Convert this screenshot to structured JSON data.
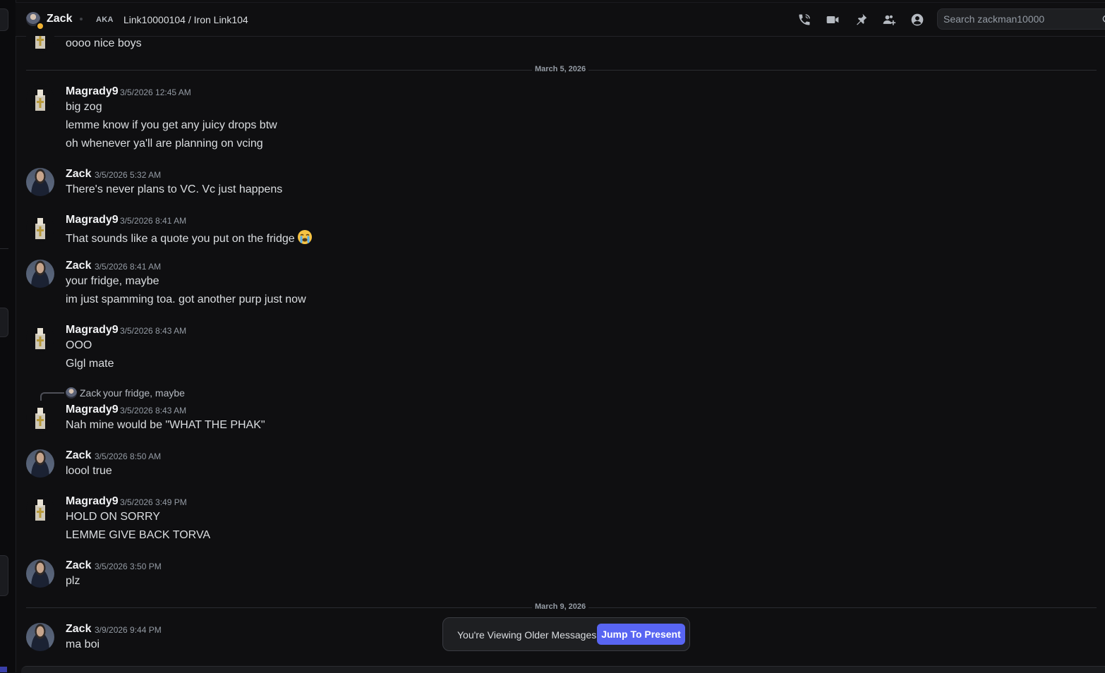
{
  "header": {
    "name": "Zack",
    "aka_label": "AKA",
    "aliases": "Link10000104 / Iron Link104",
    "search_placeholder": "Search zackman10000",
    "icons": [
      "voice-call-icon",
      "video-call-icon",
      "pin-icon",
      "add-friends-icon",
      "user-profile-icon",
      "search-icon"
    ],
    "status_color": "#f0b232"
  },
  "top_message": "oooo nice boys",
  "dividers": [
    "March 5, 2026",
    "March 9, 2026"
  ],
  "groups": [
    {
      "user": "Magrady9",
      "time": "3/5/2026 12:45 AM",
      "lines": [
        "big zog",
        "lemme know if you get any juicy drops btw",
        "oh whenever ya'll are planning on vcing"
      ]
    },
    {
      "user": "Zack",
      "time": "3/5/2026 5:32 AM",
      "lines": [
        "There's never plans to VC. Vc just happens"
      ]
    },
    {
      "user": "Magrady9",
      "time": "3/5/2026 8:41 AM",
      "lines": [
        "That sounds like a quote you put on the fridge"
      ]
    },
    {
      "user": "Zack",
      "time": "3/5/2026 8:41 AM",
      "lines": [
        "your fridge, maybe",
        "im just spamming toa. got another purp just now"
      ]
    },
    {
      "user": "Magrady9",
      "time": "3/5/2026 8:43 AM",
      "lines": [
        "OOO",
        "Glgl mate"
      ]
    },
    {
      "user": "Magrady9",
      "time": "3/5/2026 8:43 AM",
      "lines": [
        "Nah mine would be \"WHAT THE PHAK\""
      ],
      "reply": {
        "user": "Zack",
        "text": "your fridge, maybe"
      }
    },
    {
      "user": "Zack",
      "time": "3/5/2026 8:50 AM",
      "lines": [
        "loool true"
      ]
    },
    {
      "user": "Magrady9",
      "time": "3/5/2026 3:49 PM",
      "lines": [
        "HOLD ON SORRY",
        "LEMME GIVE BACK TORVA"
      ]
    },
    {
      "user": "Zack",
      "time": "3/5/2026 3:50 PM",
      "lines": [
        "plz"
      ]
    },
    {
      "user": "Zack",
      "time": "3/9/2026 9:44 PM",
      "lines": [
        "ma boi"
      ]
    }
  ],
  "jump_bar": {
    "text": "You're Viewing Older Messages",
    "button": "Jump To Present"
  },
  "accent_color": "#5865f2"
}
